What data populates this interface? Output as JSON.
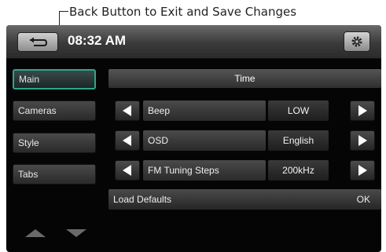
{
  "annotation": {
    "text": "Back Button to Exit and Save Changes"
  },
  "header": {
    "time": "08:32 AM",
    "back_icon": "return-arrow-icon",
    "settings_icon": "gear-icon"
  },
  "sidebar": {
    "items": [
      {
        "label": "Main",
        "active": true
      },
      {
        "label": "Cameras",
        "active": false
      },
      {
        "label": "Style",
        "active": false
      },
      {
        "label": "Tabs",
        "active": false
      }
    ],
    "scroll_up_icon": "triangle-up-icon",
    "scroll_down_icon": "triangle-down-icon"
  },
  "main": {
    "section_title": "Time",
    "settings": [
      {
        "label": "Beep",
        "value": "LOW"
      },
      {
        "label": "OSD",
        "value": "English"
      },
      {
        "label": "FM Tuning Steps",
        "value": "200kHz"
      }
    ],
    "defaults": {
      "label": "Load Defaults",
      "action": "OK"
    }
  },
  "colors": {
    "active_border": "#2fa58a",
    "background": "#050505"
  }
}
